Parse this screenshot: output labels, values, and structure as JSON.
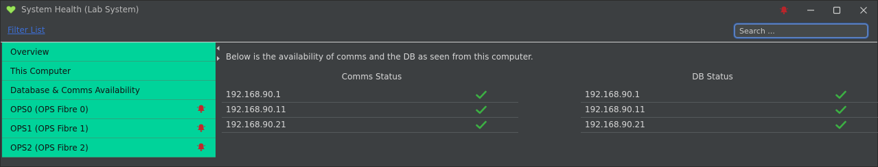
{
  "window": {
    "title": "System Health (Lab System)"
  },
  "toolbar": {
    "filter_label": "Filter List",
    "search_placeholder": "Search ..."
  },
  "sidebar": {
    "items": [
      {
        "label": "Overview",
        "alarm": false
      },
      {
        "label": "This Computer",
        "alarm": false
      },
      {
        "label": "Database & Comms Availability",
        "alarm": false
      },
      {
        "label": "OPS0 (OPS Fibre 0)",
        "alarm": true
      },
      {
        "label": "OPS1 (OPS Fibre 1)",
        "alarm": true
      },
      {
        "label": "OPS2 (OPS Fibre 2)",
        "alarm": true
      }
    ]
  },
  "main": {
    "intro": "Below is the availability of comms and the DB as seen from this computer.",
    "comms": {
      "title": "Comms Status",
      "rows": [
        {
          "ip": "192.168.90.1",
          "status": "ok"
        },
        {
          "ip": "192.168.90.11",
          "status": "ok"
        },
        {
          "ip": "192.168.90.21",
          "status": "ok"
        }
      ]
    },
    "db": {
      "title": "DB Status",
      "rows": [
        {
          "ip": "192.168.90.1",
          "status": "ok"
        },
        {
          "ip": "192.168.90.11",
          "status": "ok"
        },
        {
          "ip": "192.168.90.21",
          "status": "ok"
        }
      ]
    }
  },
  "colors": {
    "background": "#3c3f41",
    "sidebar_item": "#00d39a",
    "link": "#3d6fd6",
    "check": "#3cb043",
    "alarm": "#c0282d"
  }
}
